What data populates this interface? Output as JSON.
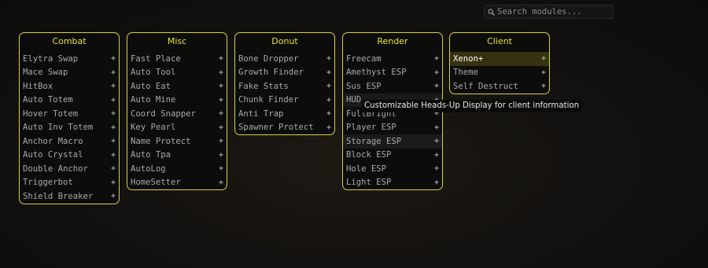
{
  "search": {
    "placeholder": "Search modules..."
  },
  "tooltip": {
    "text": "Customizable Heads-Up Display for client information"
  },
  "colors": {
    "accent": "#d8d23a",
    "background": "#0d0c0b",
    "selected": "#35330f"
  },
  "panels": [
    {
      "title": "Combat",
      "modules": [
        "Elytra Swap",
        "Mace Swap",
        "HitBox",
        "Auto Totem",
        "Hover Totem",
        "Auto Inv Totem",
        "Anchor Macro",
        "Auto Crystal",
        "Double Anchor",
        "Triggerbot",
        "Shield Breaker"
      ]
    },
    {
      "title": "Misc",
      "modules": [
        "Fast Place",
        "Auto Tool",
        "Auto Eat",
        "Auto Mine",
        "Coord Snapper",
        "Key Pearl",
        "Name Protect",
        "Auto Tpa",
        "AutoLog",
        "HomeSetter"
      ]
    },
    {
      "title": "Donut",
      "modules": [
        "Bone Dropper",
        "Growth Finder",
        "Fake Stats",
        "Chunk Finder",
        "Anti Trap",
        "Spawner Protect"
      ]
    },
    {
      "title": "Render",
      "modules": [
        "Freecam",
        "Amethyst ESP",
        "Sus ESP",
        "HUD",
        "FullBright",
        "Player ESP",
        "Storage ESP",
        "Block ESP",
        "Hole ESP",
        "Light ESP"
      ]
    },
    {
      "title": "Client",
      "modules": [
        "Xenon+",
        "Theme",
        "Self Destruct"
      ]
    }
  ],
  "expand_symbol": "+"
}
